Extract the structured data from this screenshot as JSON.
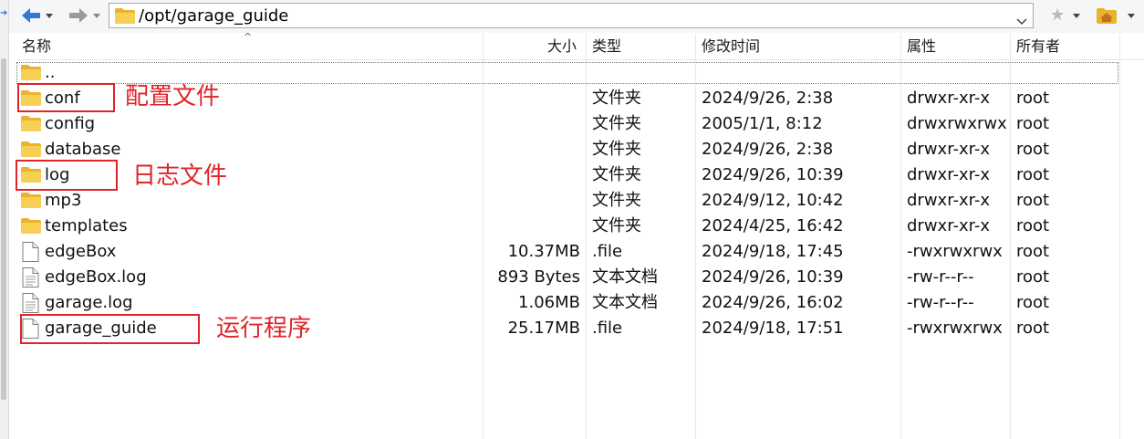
{
  "address_bar": {
    "path": "/opt/garage_guide"
  },
  "columns": {
    "name": "名称",
    "size": "大小",
    "type": "类型",
    "modified": "修改时间",
    "attributes": "属性",
    "owner": "所有者"
  },
  "parent_row": {
    "name": ".."
  },
  "files": [
    {
      "icon": "folder-icon",
      "name": "conf",
      "size": "",
      "type": "文件夹",
      "modified": "2024/9/26, 2:38",
      "attributes": "drwxr-xr-x",
      "owner": "root"
    },
    {
      "icon": "folder-icon",
      "name": "config",
      "size": "",
      "type": "文件夹",
      "modified": "2005/1/1, 8:12",
      "attributes": "drwxrwxrwx",
      "owner": "root"
    },
    {
      "icon": "folder-icon",
      "name": "database",
      "size": "",
      "type": "文件夹",
      "modified": "2024/9/26, 2:38",
      "attributes": "drwxr-xr-x",
      "owner": "root"
    },
    {
      "icon": "folder-icon",
      "name": "log",
      "size": "",
      "type": "文件夹",
      "modified": "2024/9/26, 10:39",
      "attributes": "drwxr-xr-x",
      "owner": "root"
    },
    {
      "icon": "folder-icon",
      "name": "mp3",
      "size": "",
      "type": "文件夹",
      "modified": "2024/9/12, 10:42",
      "attributes": "drwxr-xr-x",
      "owner": "root"
    },
    {
      "icon": "folder-icon",
      "name": "templates",
      "size": "",
      "type": "文件夹",
      "modified": "2024/4/25, 16:42",
      "attributes": "drwxr-xr-x",
      "owner": "root"
    },
    {
      "icon": "file-icon",
      "name": "edgeBox",
      "size": "10.37MB",
      "type": ".file",
      "modified": "2024/9/18, 17:45",
      "attributes": "-rwxrwxrwx",
      "owner": "root"
    },
    {
      "icon": "text-file-icon",
      "name": "edgeBox.log",
      "size": "893 Bytes",
      "type": "文本文档",
      "modified": "2024/9/26, 10:39",
      "attributes": "-rw-r--r--",
      "owner": "root"
    },
    {
      "icon": "text-file-icon",
      "name": "garage.log",
      "size": "1.06MB",
      "type": "文本文档",
      "modified": "2024/9/26, 16:02",
      "attributes": "-rw-r--r--",
      "owner": "root"
    },
    {
      "icon": "file-icon",
      "name": "garage_guide",
      "size": "25.17MB",
      "type": ".file",
      "modified": "2024/9/18, 17:51",
      "attributes": "-rwxrwxrwx",
      "owner": "root"
    }
  ],
  "annotations": {
    "conf": "配置文件",
    "log": "日志文件",
    "program": "运行程序"
  },
  "colors": {
    "annotation_red": "#e0242a",
    "folder_yellow": "#f3c443",
    "nav_blue": "#2a7ad6"
  }
}
